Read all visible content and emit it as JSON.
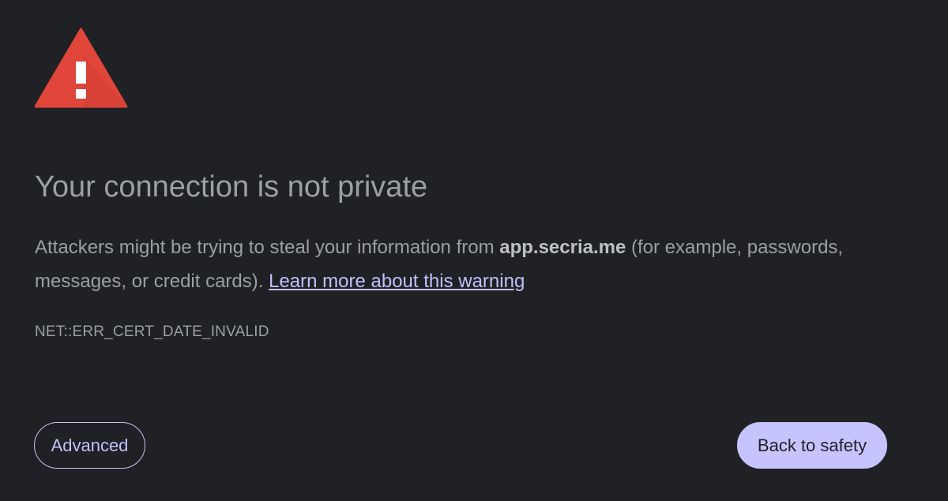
{
  "colors": {
    "background": "#202124",
    "warning_red": "#e1463a",
    "text": "#9aa0a6",
    "link": "#c2c0ff",
    "primary_button": "#c6c4ff"
  },
  "icon": "warning-triangle-icon",
  "interstitial": {
    "title": "Your connection is not private",
    "description_before_host": "Attackers might be trying to steal your information from ",
    "host": "app.secria.me",
    "description_after_host": " (for example, passwords, messages, or credit cards). ",
    "learn_more_link": "Learn more about this warning",
    "error_code": "NET::ERR_CERT_DATE_INVALID"
  },
  "buttons": {
    "advanced": "Advanced",
    "back_to_safety": "Back to safety"
  }
}
